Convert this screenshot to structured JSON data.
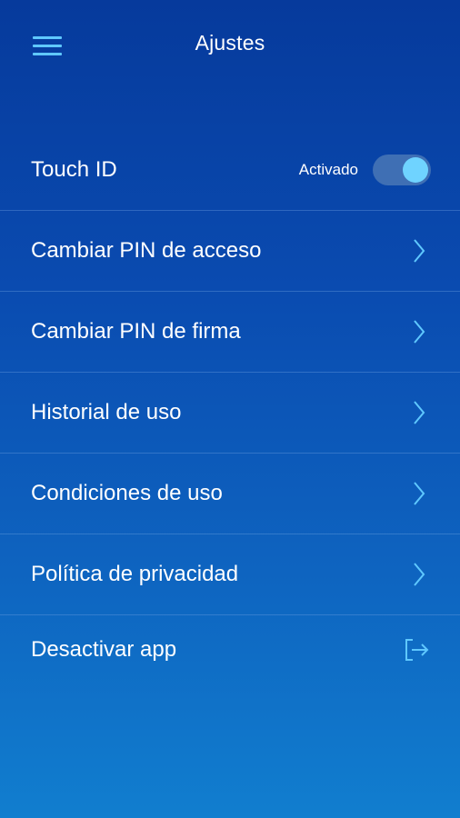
{
  "header": {
    "title": "Ajustes",
    "menu_icon": "hamburger-menu-icon"
  },
  "colors": {
    "accent": "#5fc8ff",
    "toggle_on_knob": "#6fd3ff",
    "background_top": "#063a9c",
    "background_bottom": "#117ecf"
  },
  "settings": {
    "touch_id": {
      "label": "Touch ID",
      "status": "Activado",
      "enabled": true
    },
    "items": [
      {
        "label": "Cambiar PIN de acceso",
        "icon": "chevron-right-icon"
      },
      {
        "label": "Cambiar PIN de firma",
        "icon": "chevron-right-icon"
      },
      {
        "label": "Historial de uso",
        "icon": "chevron-right-icon"
      },
      {
        "label": "Condiciones de uso",
        "icon": "chevron-right-icon"
      },
      {
        "label": "Política de privacidad",
        "icon": "chevron-right-icon"
      }
    ],
    "deactivate": {
      "label": "Desactivar app",
      "icon": "exit-icon"
    }
  }
}
